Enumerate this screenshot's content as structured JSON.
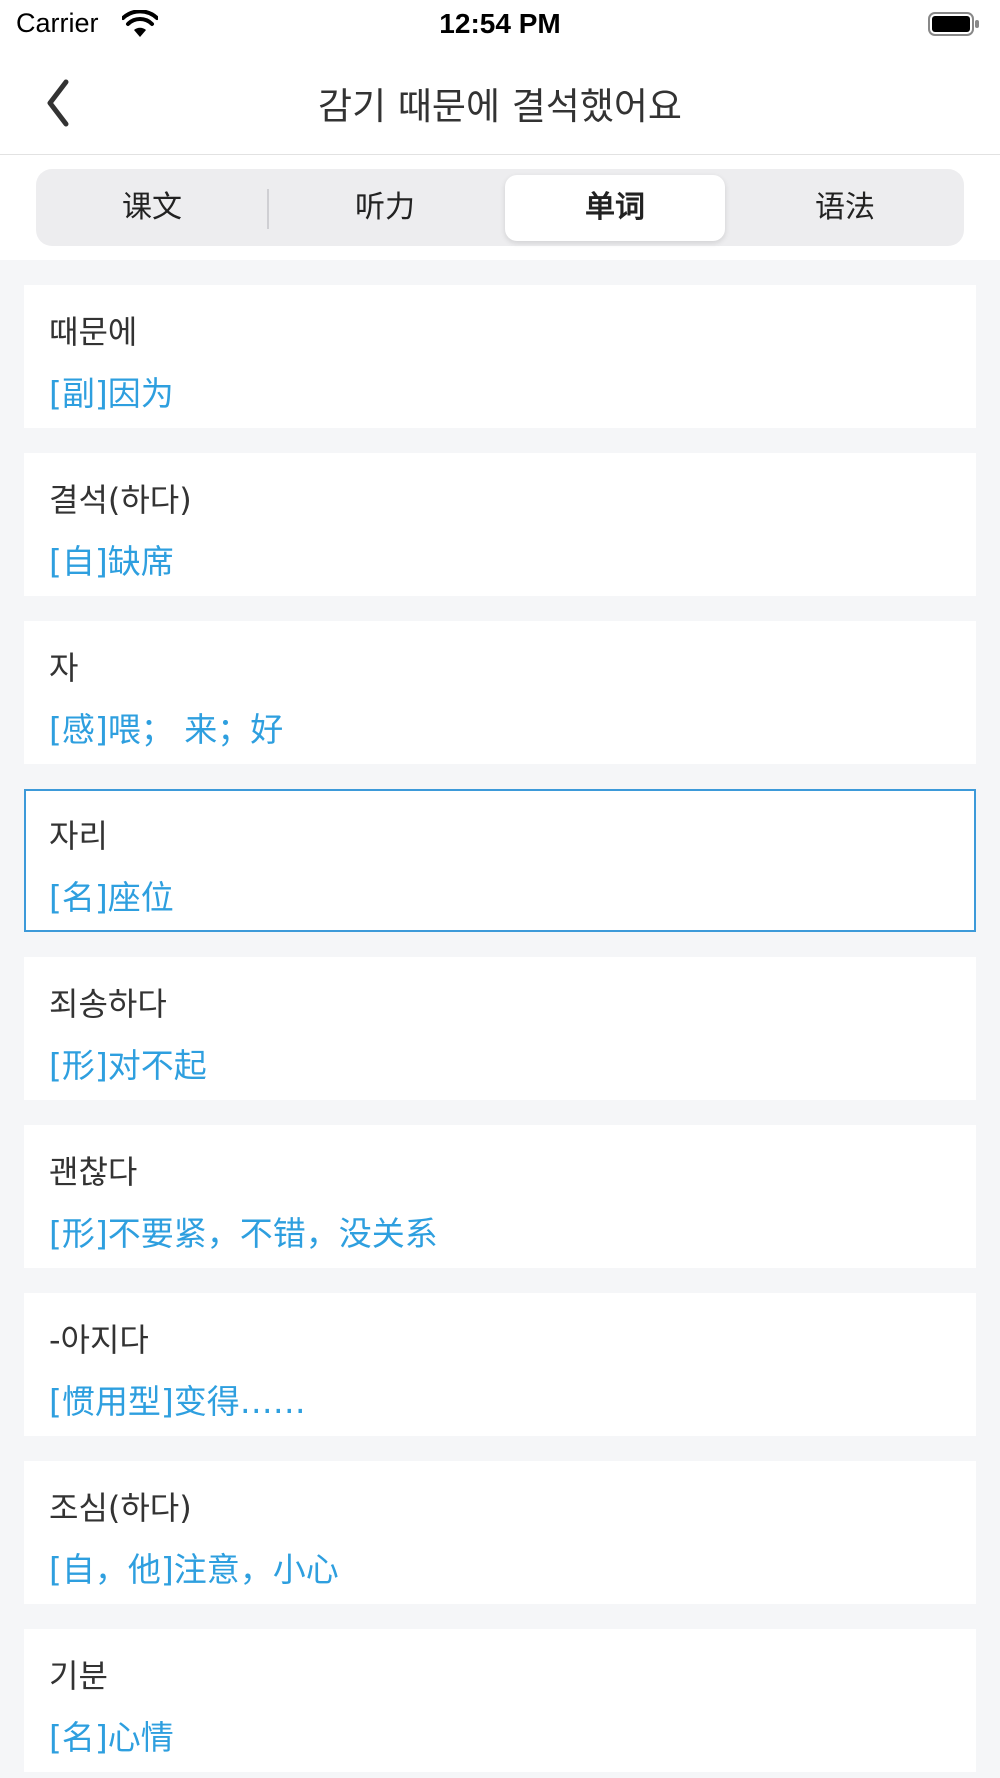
{
  "status_bar": {
    "carrier": "Carrier",
    "time": "12:54 PM"
  },
  "nav": {
    "title": "감기 때문에 결석했어요"
  },
  "tabs": [
    {
      "label": "课文",
      "active": false
    },
    {
      "label": "听力",
      "active": false
    },
    {
      "label": "单词",
      "active": true
    },
    {
      "label": "语法",
      "active": false
    }
  ],
  "words": [
    {
      "term": "때문에",
      "definition": "[副]因为",
      "selected": false
    },
    {
      "term": "결석(하다)",
      "definition": "[自]缺席",
      "selected": false
    },
    {
      "term": "자",
      "definition": "[感]喂；  来；好",
      "selected": false
    },
    {
      "term": "자리",
      "definition": "[名]座位",
      "selected": true
    },
    {
      "term": "죄송하다",
      "definition": "[形]对不起",
      "selected": false
    },
    {
      "term": "괜찮다",
      "definition": "[形]不要紧，不错，没关系",
      "selected": false
    },
    {
      "term": "-아지다",
      "definition": "[惯用型]变得……",
      "selected": false
    },
    {
      "term": "조심(하다)",
      "definition": "[自，他]注意，小心",
      "selected": false
    },
    {
      "term": "기분",
      "definition": "[名]心情",
      "selected": false
    }
  ],
  "colors": {
    "accent": "#2e9fdf",
    "selected_border": "#3d9ad9",
    "background": "#f5f6f8"
  },
  "icons": {
    "back": "chevron-left-icon",
    "wifi": "wifi-icon",
    "battery": "battery-icon"
  }
}
